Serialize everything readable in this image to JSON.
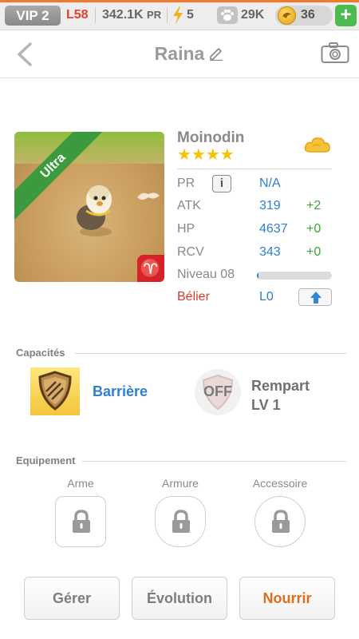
{
  "status_bar": {
    "vip": "VIP 2",
    "level": "L58",
    "pr_value": "342.1K",
    "pr_unit": "PR",
    "energy": "5",
    "paws": "29K",
    "coins": "36",
    "add_label": "+"
  },
  "header": {
    "title": "Raina"
  },
  "monster": {
    "rarity": "Ultra",
    "name": "Moinodin",
    "stars": "★★★★",
    "zodiac_glyph": "♈"
  },
  "stats": {
    "pr": {
      "label": "PR",
      "value": "N/A",
      "info_label": "i"
    },
    "atk": {
      "label": "ATK",
      "value": "319",
      "bonus": "+2"
    },
    "hp": {
      "label": "HP",
      "value": "4637",
      "bonus": "+0"
    },
    "rcv": {
      "label": "RCV",
      "value": "343",
      "bonus": "+0"
    },
    "level": {
      "label": "Niveau 08",
      "progress": 0.02
    },
    "sign": {
      "label": "Bélier",
      "value": "L0"
    }
  },
  "abilities": {
    "title": "Capacités",
    "skill_name": "Barrière",
    "leader_state": "OFF",
    "leader_name": "Rempart",
    "leader_level": "LV 1"
  },
  "equipment": {
    "title": "Equipement",
    "weapon": "Arme",
    "armor": "Armure",
    "accessory": "Accessoire"
  },
  "actions": {
    "manage": "Gérer",
    "evolve": "Évolution",
    "feed": "Nourrir"
  },
  "colors": {
    "accent_orange": "#e06b1f",
    "stat_blue": "#2e7fcf",
    "bonus_green": "#3aa53a",
    "ultra_green": "#3a9a3d",
    "zodiac_red": "#d8222a"
  },
  "icons": {
    "back": "chevron-left-icon",
    "edit": "pencil-icon",
    "camera": "camera-icon",
    "energy": "lightning-icon",
    "paw": "paw-icon",
    "coin": "coin-icon",
    "element": "cloud-element-icon",
    "skill": "shield-icon",
    "lock": "lock-icon",
    "upgrade": "arrow-up-icon"
  }
}
